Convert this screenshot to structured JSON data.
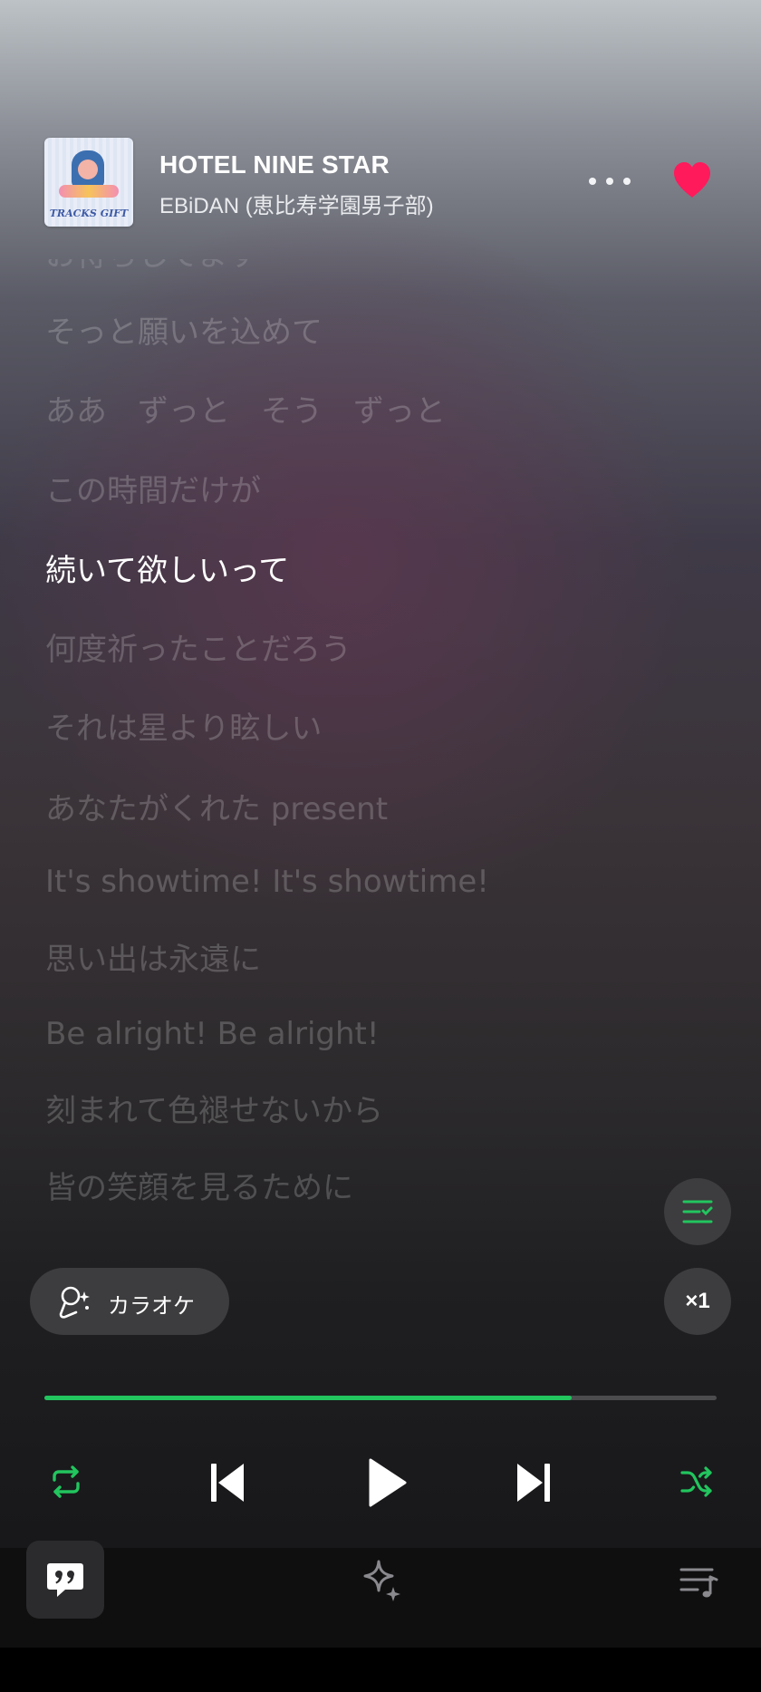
{
  "header": {
    "album_art_caption": "TRACKS GIFT",
    "title": "HOTEL NINE STAR",
    "artist": "EBiDAN (恵比寿学園男子部)",
    "liked": true,
    "heart_color": "#ff1a5c"
  },
  "lyrics": {
    "lines": [
      "お待ちしてます",
      "そっと願いを込めて",
      "ああ　ずっと　そう　ずっと",
      "この時間だけが",
      "続いて欲しいって",
      "何度祈ったことだろう",
      "それは星より眩しい",
      "あなたがくれた present",
      "It's showtime! It's showtime!",
      "思い出は永遠に",
      "Be alright! Be alright!",
      "刻まれて色褪せないから",
      "皆の笑顔を見るために"
    ],
    "current_index": 4
  },
  "controls": {
    "karaoke_label": "カラオケ",
    "speed_label": "×1",
    "progress": 0.785,
    "accent_color": "#22c55e",
    "icons": [
      "lyrics-list-icon",
      "microphone-sparkle-icon",
      "repeat-icon",
      "previous-icon",
      "play-icon",
      "next-icon",
      "shuffle-icon"
    ]
  },
  "bottom_nav": {
    "icons": [
      "lyrics-quote-icon",
      "sparkle-icon",
      "queue-icon"
    ]
  }
}
